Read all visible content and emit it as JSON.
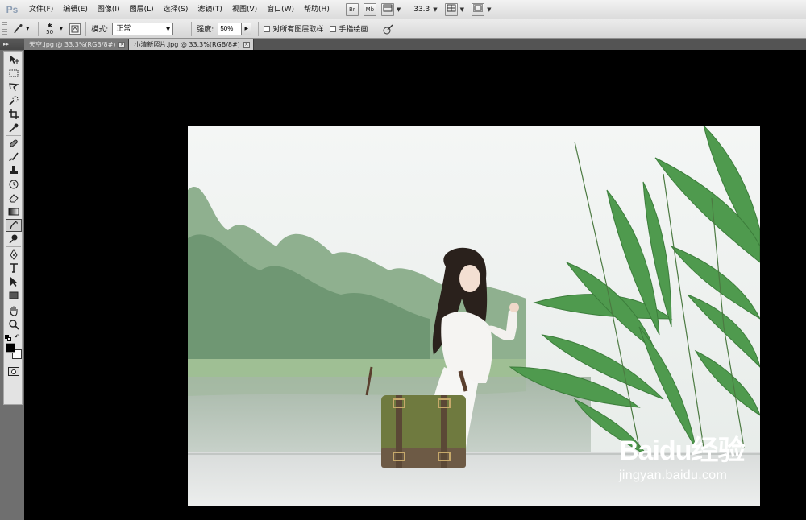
{
  "app": {
    "logo": "Ps"
  },
  "menu": {
    "items": [
      "文件(F)",
      "编辑(E)",
      "图像(I)",
      "图层(L)",
      "选择(S)",
      "滤镜(T)",
      "视图(V)",
      "窗口(W)",
      "帮助(H)"
    ],
    "bridge_button": "Br",
    "minibridge_button": "Mb",
    "zoom": "33.3"
  },
  "options": {
    "brush_size": "50",
    "mode_label": "模式:",
    "mode_value": "正常",
    "strength_label": "强度:",
    "strength_value": "50%",
    "sample_all_layers": "对所有图层取样",
    "finger_painting": "手指绘画"
  },
  "tabs": [
    {
      "label": "天空.jpg @ 33.3%(RGB/8#)",
      "active": false
    },
    {
      "label": "小清新照片.jpg @ 33.3%(RGB/8#)",
      "active": true
    }
  ],
  "tools": [
    "move-tool-icon",
    "marquee-tool-icon",
    "lasso-tool-icon",
    "quick-select-tool-icon",
    "crop-tool-icon",
    "eyedropper-tool-icon",
    "healing-brush-tool-icon",
    "brush-tool-icon",
    "clone-stamp-tool-icon",
    "history-brush-tool-icon",
    "eraser-tool-icon",
    "gradient-tool-icon",
    "smudge-tool-icon",
    "dodge-tool-icon",
    "pen-tool-icon",
    "type-tool-icon",
    "path-select-tool-icon",
    "shape-tool-icon",
    "hand-tool-icon",
    "zoom-tool-icon"
  ],
  "active_tool": "smudge-tool-icon",
  "colors": {
    "foreground": "#000000",
    "background": "#ffffff",
    "workspace": "#000000",
    "panel": "#6f6f6f"
  },
  "watermark": {
    "logo": "Baidu经验",
    "url": "jingyan.baidu.com"
  }
}
